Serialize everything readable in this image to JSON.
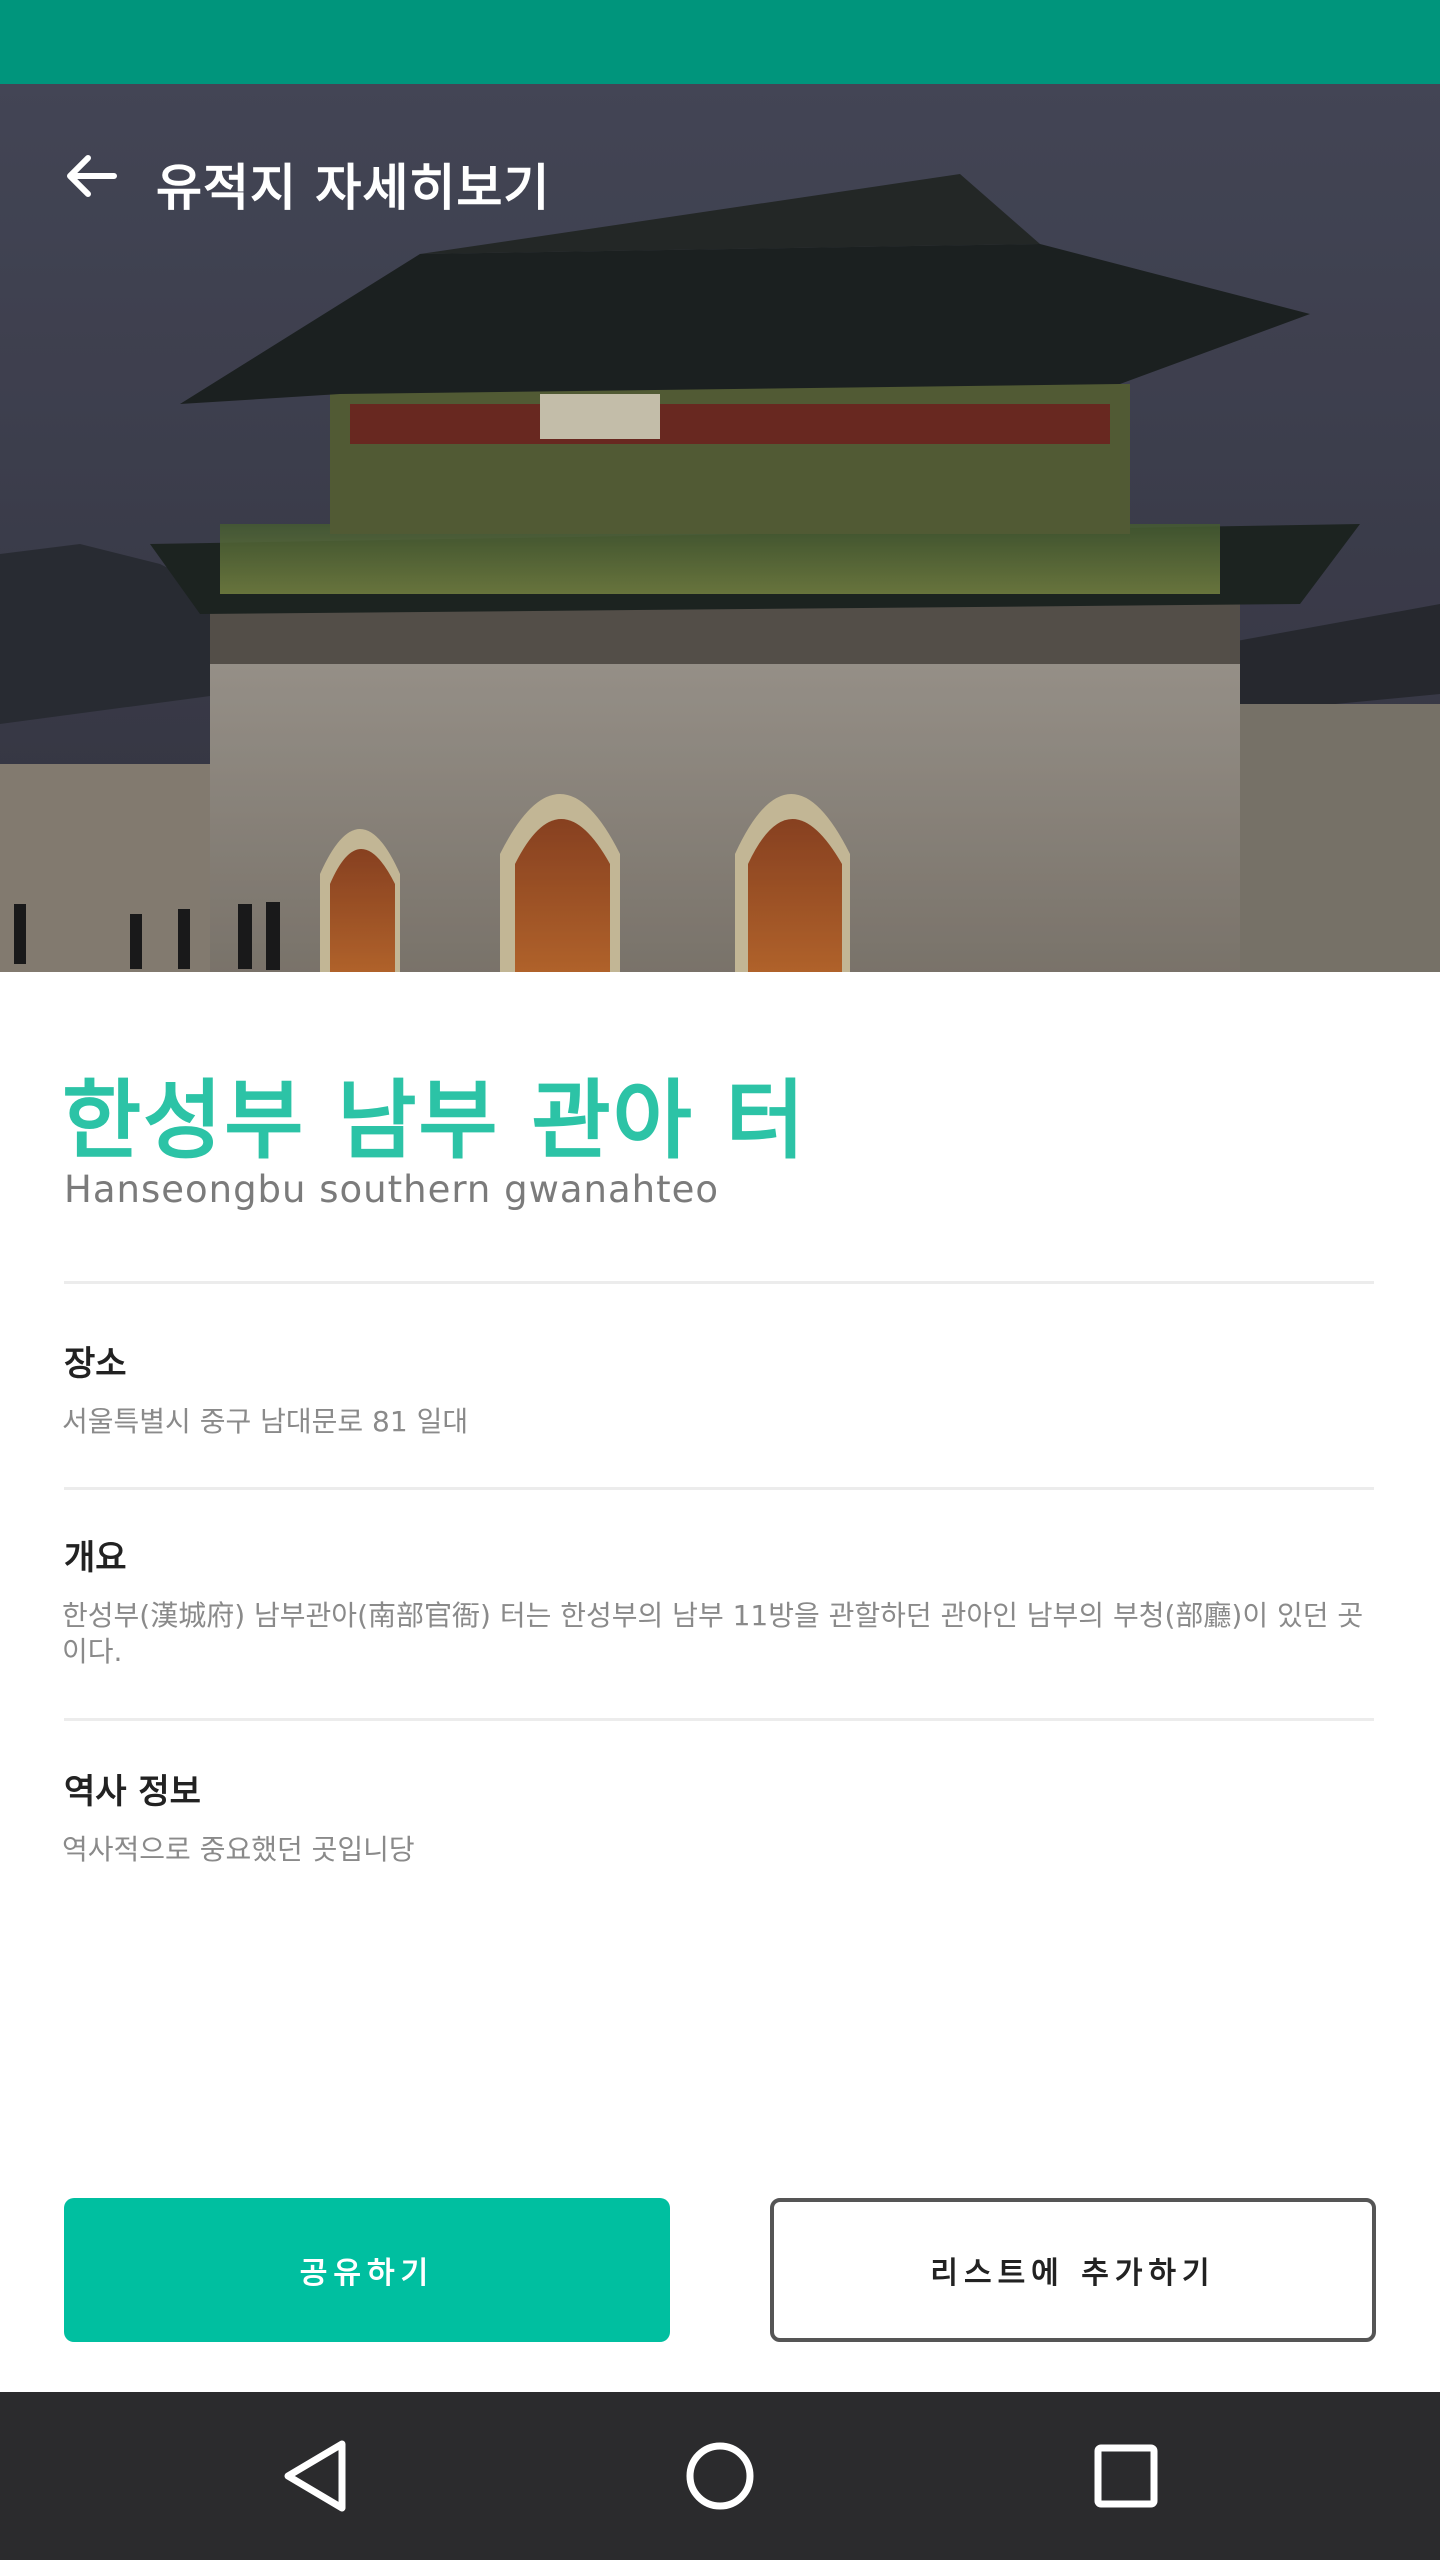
{
  "toolbar": {
    "title": "유적지 자세히보기",
    "back_icon": "arrow-left-icon"
  },
  "hero": {
    "image": "palace-gate-photo"
  },
  "site": {
    "name": "한성부 남부 관아 터",
    "name_en": "Hanseongbu southern gwanahteo"
  },
  "sections": [
    {
      "label": "장소",
      "text": "서울특별시 중구 남대문로 81 일대"
    },
    {
      "label": "개요",
      "text": "한성부(漢城府) 남부관아(南部官衙) 터는 한성부의 남부 11방을 관할하던 관아인 남부의 부청(部廳)이 있던 곳이다."
    },
    {
      "label": "역사 정보",
      "text": "역사적으로 중요했던 곳입니당"
    }
  ],
  "buttons": {
    "share": "공유하기",
    "add_to_list": "리스트에 추가하기"
  },
  "navbar": {
    "back_icon": "triangle-back-icon",
    "home_icon": "circle-home-icon",
    "recent_icon": "square-recents-icon"
  },
  "colors": {
    "status_bar": "#00957c",
    "accent": "#2cc3a6",
    "share_button": "#00bfa0",
    "nav_bar": "#2b2b2d"
  }
}
